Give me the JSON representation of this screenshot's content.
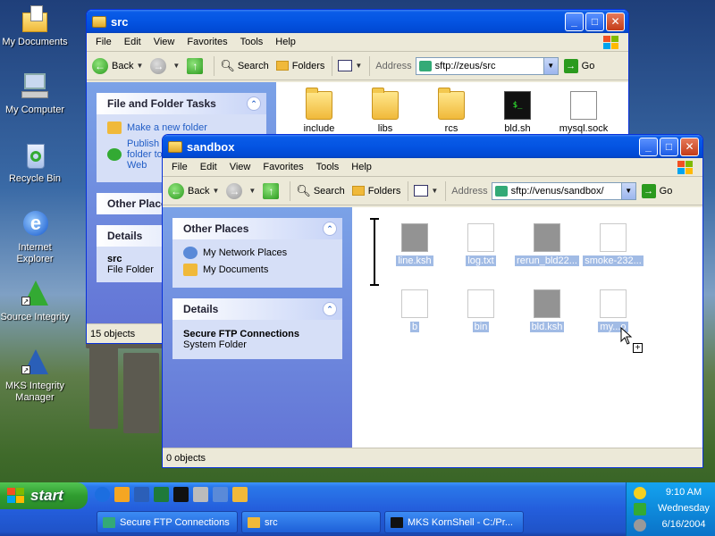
{
  "desktop": {
    "icons": [
      {
        "label": "My Documents"
      },
      {
        "label": "My Computer"
      },
      {
        "label": "Recycle Bin"
      },
      {
        "label": "Internet Explorer"
      },
      {
        "label": "Source Integrity"
      },
      {
        "label": "MKS Integrity Manager"
      }
    ]
  },
  "menus": [
    "File",
    "Edit",
    "View",
    "Favorites",
    "Tools",
    "Help"
  ],
  "toolbar": {
    "back": "Back",
    "search": "Search",
    "folders": "Folders",
    "address_label": "Address",
    "go": "Go"
  },
  "src_window": {
    "title": "src",
    "address": "sftp://zeus/src",
    "tasks_title": "File and Folder Tasks",
    "tasks": [
      "Make a new folder",
      "Publish this folder to the Web"
    ],
    "other_places_title": "Other Places",
    "details_title": "Details",
    "details_name": "src",
    "details_type": "File Folder",
    "files": [
      "include",
      "libs",
      "rcs",
      "bld.sh",
      "mysql.sock"
    ],
    "status": "15 objects"
  },
  "sandbox_window": {
    "title": "sandbox",
    "address": "sftp://venus/sandbox/",
    "other_places_title": "Other Places",
    "other_places": [
      "My Network Places",
      "My Documents"
    ],
    "details_title": "Details",
    "details_name": "Secure FTP Connections",
    "details_type": "System Folder",
    "ghost_files": [
      "line.ksh",
      "log.txt",
      "rerun_bld22...",
      "smoke-232...",
      "b",
      "bin",
      "bld.ksh",
      "my...o"
    ],
    "status": "0 objects"
  },
  "taskbar": {
    "start": "start",
    "tasks": [
      "Secure FTP Connections",
      "src",
      "MKS KornShell - C:/Pr..."
    ],
    "time": "9:10 AM",
    "day": "Wednesday",
    "date": "6/16/2004"
  }
}
